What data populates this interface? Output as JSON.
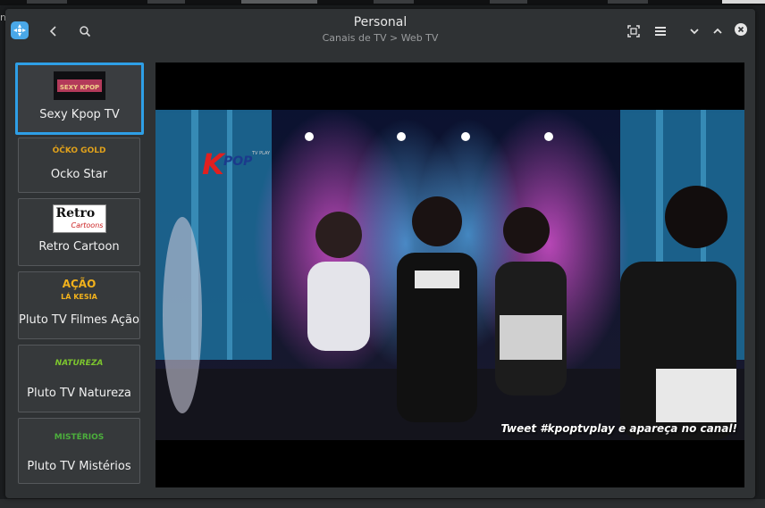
{
  "window": {
    "title": "Personal",
    "breadcrumb": "Canais de TV > Web TV"
  },
  "desktop": {
    "left_char": "n"
  },
  "channels": [
    {
      "label": "Sexy Kpop TV",
      "logo_text": "SEXY KPOP",
      "selected": true
    },
    {
      "label": "Ocko Star",
      "logo_text": "ÓČKO GOLD"
    },
    {
      "label": "Retro Cartoon",
      "logo_text_1": "Retro",
      "logo_text_2": "Cartoons"
    },
    {
      "label": "Pluto TV Filmes Ação",
      "logo_text_1": "AÇÃO",
      "logo_text_2": "LÁ KESIA"
    },
    {
      "label": "Pluto TV Natureza",
      "logo_text": "NATUREZA"
    },
    {
      "label": "Pluto TV Mistérios",
      "logo_text": "MISTÉRIOS"
    }
  ],
  "player": {
    "channel_logo": "K POP",
    "channel_logo_small": "TV PLAY",
    "overlay_text": "Tweet #kpoptvplay e apareça no canal!"
  },
  "icons": {
    "back": "chevron-left-icon",
    "search": "search-icon",
    "fullscreen": "fullscreen-icon",
    "menu": "hamburger-menu-icon",
    "minimize": "chevron-down-icon",
    "maximize": "chevron-up-icon",
    "close": "close-icon"
  },
  "colors": {
    "accent": "#2e9fe6",
    "window_bg": "#2f3234",
    "tile_bg": "#36393b"
  }
}
